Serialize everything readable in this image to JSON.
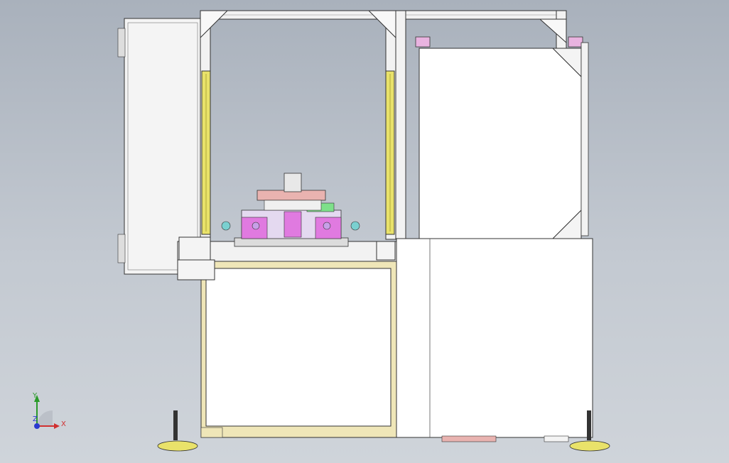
{
  "viewport": {
    "background_top": "#a9b1bc",
    "background_bottom": "#cfd4da"
  },
  "colors": {
    "frame": "#f2f2f2",
    "panel": "#ffffff",
    "outline": "#3a3a3a",
    "cylinder": "#e9e26a",
    "magenta": "#e07ae0",
    "green": "#7ee08a",
    "pink": "#e9b3b0",
    "tan": "#efe6b8",
    "axis_x": "#d03030",
    "axis_y": "#2a9a2a",
    "axis_z": "#2a3ad0"
  },
  "triad": {
    "x_label": "X",
    "y_label": "Y",
    "z_label": "Z"
  },
  "icons": {
    "view_triad": "xyz-axis-icon"
  }
}
